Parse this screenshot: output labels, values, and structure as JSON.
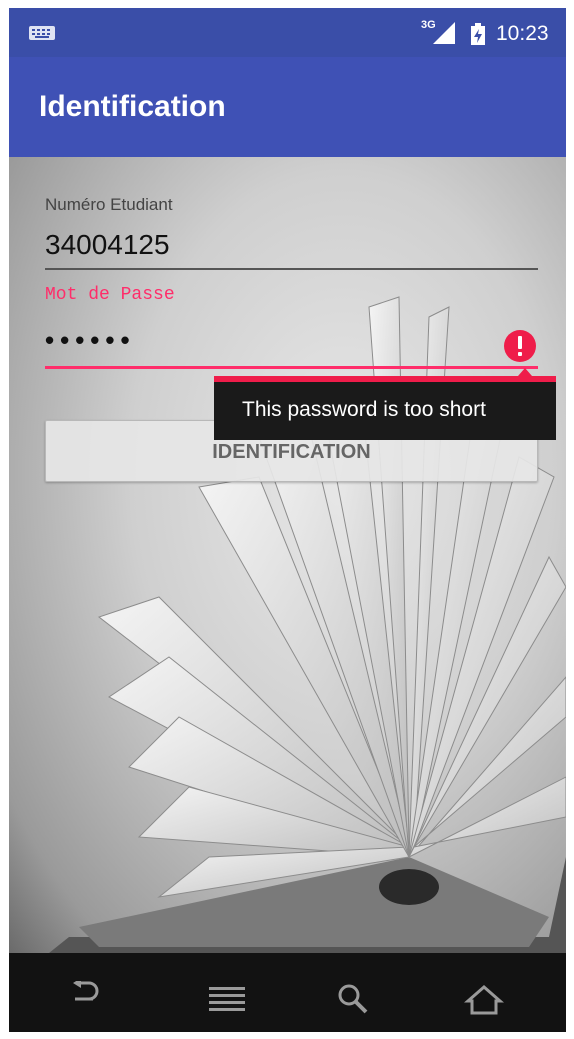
{
  "status_bar": {
    "network": "3G",
    "time": "10:23",
    "icons": [
      "keyboard-icon",
      "signal-icon",
      "battery-icon"
    ]
  },
  "app_bar": {
    "title": "Identification"
  },
  "form": {
    "student_number": {
      "label": "Numéro Etudiant",
      "value": "34004125"
    },
    "password": {
      "label": "Mot de Passe",
      "value": "••••••",
      "error": "This password is too short"
    },
    "submit_label": "IDENTIFICATION"
  },
  "nav_bar": {
    "icons": [
      "back-icon",
      "menu-icon",
      "search-icon",
      "home-icon"
    ]
  },
  "colors": {
    "status_bar": "#3a4ea8",
    "app_bar": "#3f51b5",
    "accent_error": "#ff2d6a",
    "tooltip_bg": "#1a1a1a",
    "nav_bar": "#121212"
  }
}
